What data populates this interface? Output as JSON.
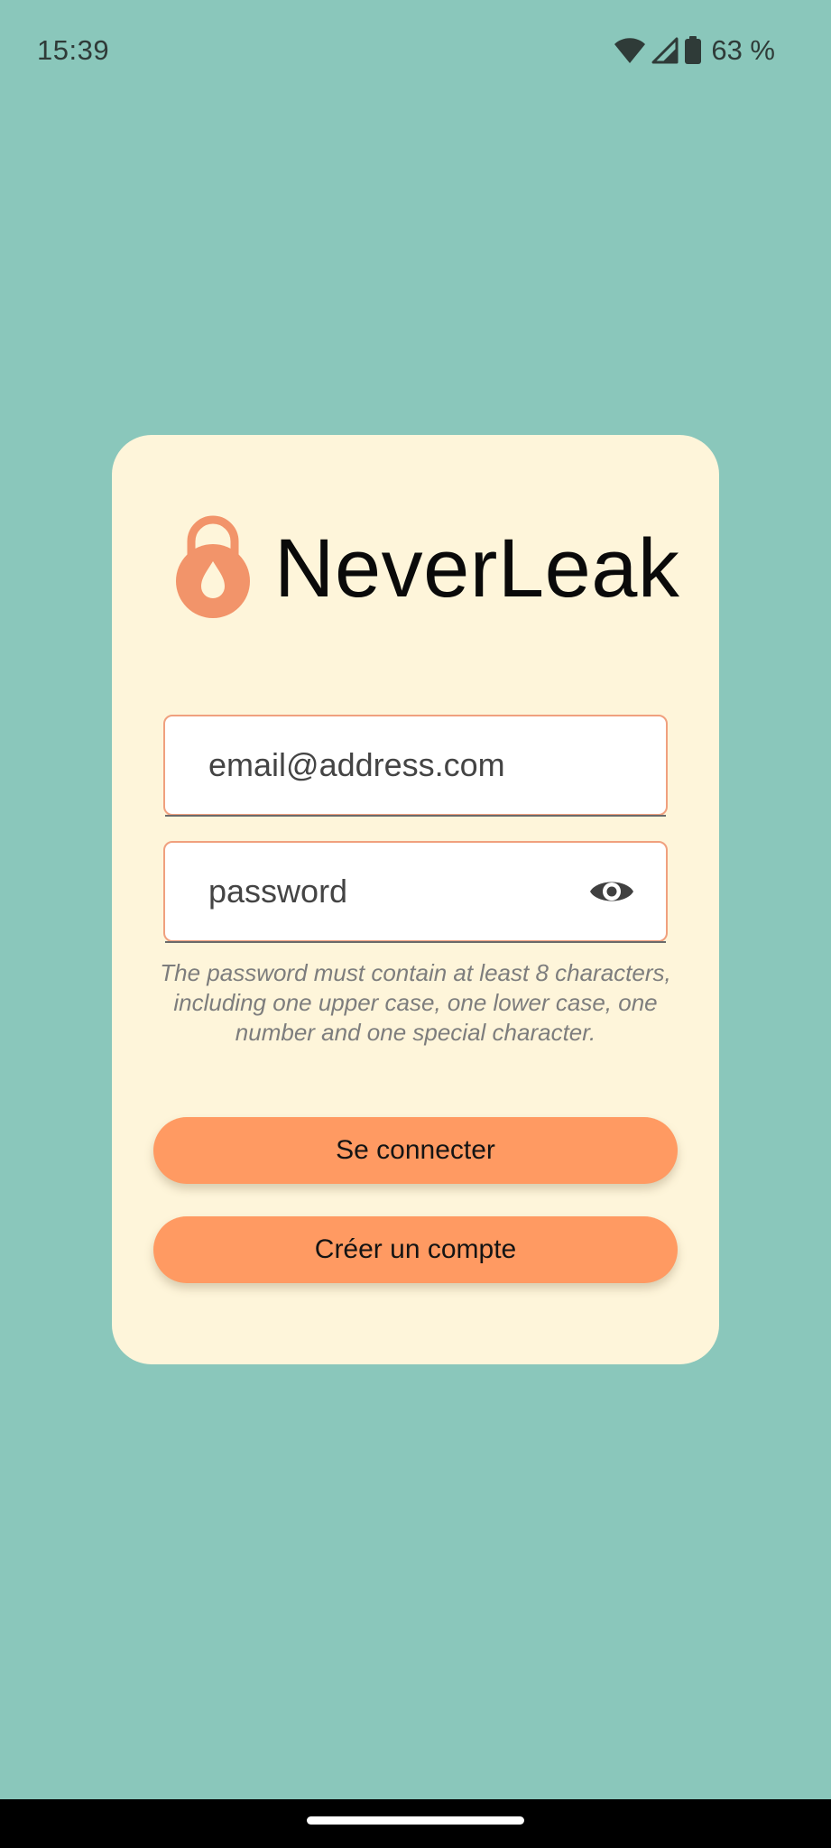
{
  "status_bar": {
    "time": "15:39",
    "battery": "63 %",
    "icons": [
      "wifi-icon",
      "signal-icon",
      "battery-icon"
    ]
  },
  "brand": {
    "app_name": "NeverLeak",
    "logo_icon": "lock-drop-icon"
  },
  "login_form": {
    "email_placeholder": "email@address.com",
    "password_placeholder": "password",
    "toggle_icon": "eye-icon",
    "password_hint": "The password must contain at least 8 characters, including one upper case, one lower case, one number and one special character.",
    "login_button": "Se connecter",
    "register_button": "Créer un compte"
  },
  "colors": {
    "background": "#8AC7BB",
    "card": "#FEF5DA",
    "accent": "#FF9A62",
    "field_border": "#F0A07E",
    "logo": "#F2946A"
  }
}
